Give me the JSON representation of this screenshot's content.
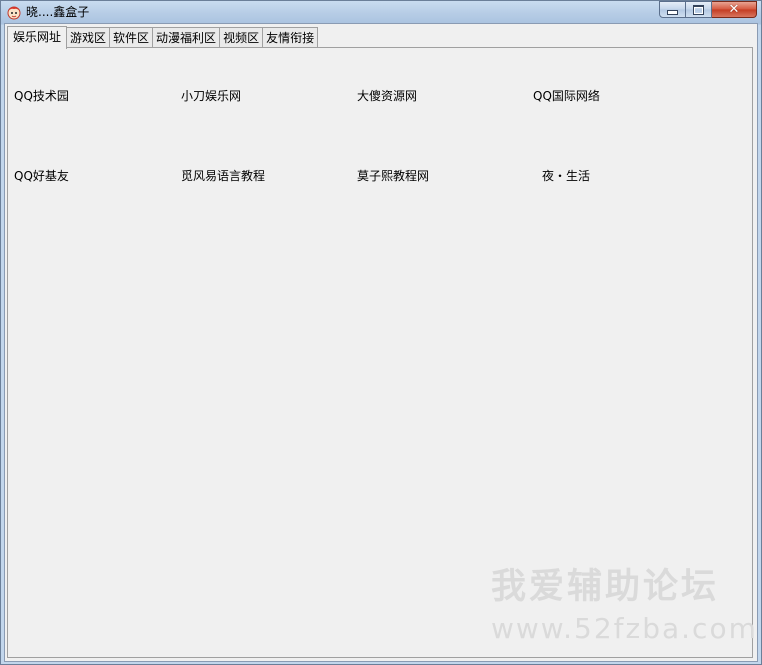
{
  "window": {
    "title": "晓....鑫盒子",
    "icon": "cartoon-app-icon",
    "controls": {
      "minimize": "minimize-icon",
      "maximize": "maximize-icon",
      "close": "close-icon"
    }
  },
  "tabs": [
    {
      "label": "娱乐网址",
      "active": true
    },
    {
      "label": "游戏区"
    },
    {
      "label": "软件区"
    },
    {
      "label": "动漫福利区"
    },
    {
      "label": "视频区"
    },
    {
      "label": "友情衔接"
    }
  ],
  "links": {
    "row1": [
      "QQ技术园",
      "小刀娱乐网",
      "大傻资源网",
      "QQ国际网络"
    ],
    "row2": [
      "QQ好基友",
      "觅风易语言教程",
      "莫子熙教程网",
      "夜・生活"
    ]
  },
  "watermark": {
    "text_cn": "我爱辅助论坛",
    "text_url": "www.52fzba.com"
  }
}
